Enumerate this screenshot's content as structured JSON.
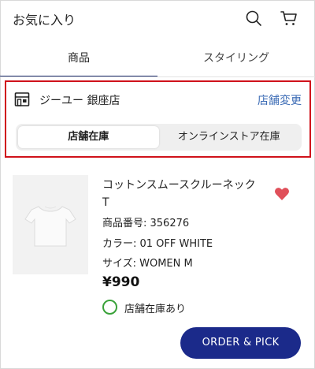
{
  "header": {
    "title": "お気に入り",
    "search_icon": "search-icon",
    "cart_icon": "cart-icon"
  },
  "tabs": [
    {
      "label": "商品",
      "active": true
    },
    {
      "label": "スタイリング",
      "active": false
    }
  ],
  "store": {
    "icon": "store-icon",
    "name": "ジーユー 銀座店",
    "change_label": "店舗変更",
    "segments": [
      {
        "label": "店舗在庫",
        "active": true
      },
      {
        "label": "オンラインストア在庫",
        "active": false
      }
    ]
  },
  "product": {
    "name": "コットンスムースクルーネックT",
    "number_line": "商品番号: 356276",
    "color_line": "カラー: 01 OFF WHITE",
    "size_line": "サイズ: WOMEN M",
    "price": "¥990",
    "stock_label": "店舗在庫あり",
    "favorited": true
  },
  "order_button": {
    "label": "ORDER & PICK"
  },
  "colors": {
    "accent_navy": "#1b2a8a",
    "highlight_red": "#d0121b",
    "link_blue": "#3b6bb5",
    "stock_green": "#3aa23a",
    "heart_red": "#e0505a"
  }
}
